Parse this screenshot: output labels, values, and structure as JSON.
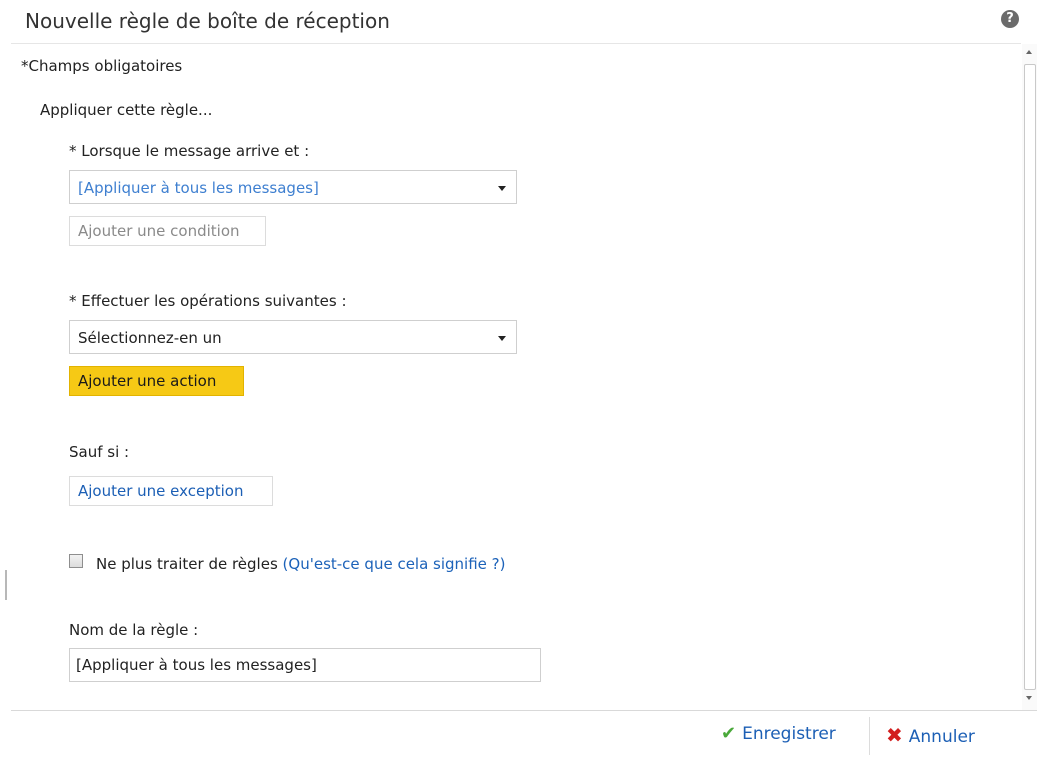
{
  "dialog": {
    "title": "Nouvelle règle de boîte de réception",
    "help_glyph": "?"
  },
  "form": {
    "required_note": "*Champs obligatoires",
    "apply_label": "Appliquer cette règle...",
    "condition": {
      "label": "* Lorsque le message arrive et :",
      "selected": "[Appliquer à tous les messages]",
      "add_button": "Ajouter une condition",
      "selected_color": "#3e7fd0"
    },
    "action": {
      "label": "* Effectuer les opérations suivantes :",
      "selected": "Sélectionnez-en un",
      "add_button": "Ajouter une action",
      "button_color": "#f6c915"
    },
    "exception": {
      "label": "Sauf si :",
      "add_button": "Ajouter une exception"
    },
    "stop_processing": {
      "checked": false,
      "label": "Ne plus traiter de règles",
      "help_link": "(Qu'est-ce que cela signifie ?)"
    },
    "rule_name": {
      "label": "Nom de la règle :",
      "value": "[Appliquer à tous les messages]"
    }
  },
  "footer": {
    "save_label": "Enregistrer",
    "cancel_label": "Annuler",
    "save_icon": "checkmark-icon",
    "cancel_icon": "x-icon"
  }
}
